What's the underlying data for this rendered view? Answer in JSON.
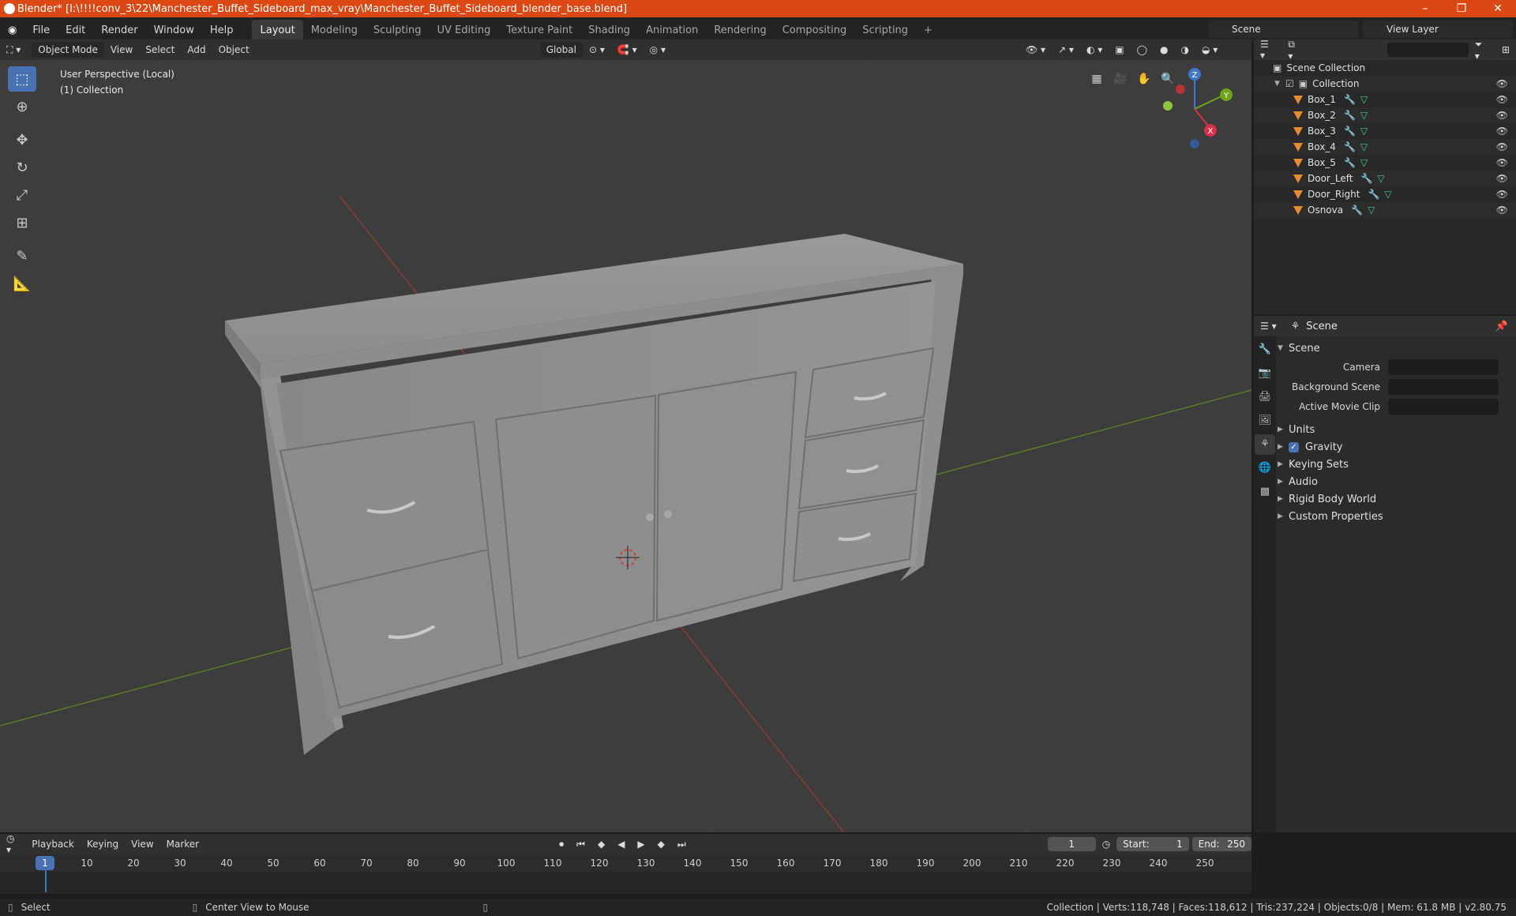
{
  "window": {
    "title": "Blender* [I:\\!!!!conv_3\\22\\Manchester_Buffet_Sideboard_max_vray\\Manchester_Buffet_Sideboard_blender_base.blend]",
    "controls": [
      "–",
      "❐",
      "✕"
    ]
  },
  "topbar": {
    "menu": [
      "File",
      "Edit",
      "Render",
      "Window",
      "Help"
    ],
    "workspaces": [
      "Layout",
      "Modeling",
      "Sculpting",
      "UV Editing",
      "Texture Paint",
      "Shading",
      "Animation",
      "Rendering",
      "Compositing",
      "Scripting"
    ],
    "active_workspace": "Layout",
    "add_workspace": "+",
    "scene": "Scene",
    "view_layer": "View Layer"
  },
  "viewport_header": {
    "mode": "Object Mode",
    "menus": [
      "View",
      "Select",
      "Add",
      "Object"
    ],
    "orientation": "Global"
  },
  "viewport": {
    "info_line1": "User Perspective (Local)",
    "info_line2": "(1) Collection",
    "gizmo": {
      "x": "X",
      "y": "Y",
      "z": "Z"
    }
  },
  "outliner": {
    "root": "Scene Collection",
    "collection": "Collection",
    "objects": [
      "Box_1",
      "Box_2",
      "Box_3",
      "Box_4",
      "Box_5",
      "Door_Left",
      "Door_Right",
      "Osnova"
    ]
  },
  "properties": {
    "context": "Scene",
    "panel": "Scene",
    "fields": [
      {
        "label": "Camera",
        "value": ""
      },
      {
        "label": "Background Scene",
        "value": ""
      },
      {
        "label": "Active Movie Clip",
        "value": ""
      }
    ],
    "sections": [
      "Units",
      "Gravity",
      "Keying Sets",
      "Audio",
      "Rigid Body World",
      "Custom Properties"
    ],
    "gravity_checked": true
  },
  "timeline": {
    "menus": [
      "Playback",
      "Keying",
      "View",
      "Marker"
    ],
    "current_frame": "1",
    "start_label": "Start:",
    "start": "1",
    "end_label": "End:",
    "end": "250",
    "ticks": [
      "1",
      "10",
      "20",
      "30",
      "40",
      "50",
      "60",
      "70",
      "80",
      "90",
      "100",
      "110",
      "120",
      "130",
      "140",
      "150",
      "160",
      "170",
      "180",
      "190",
      "200",
      "210",
      "220",
      "230",
      "240",
      "250"
    ]
  },
  "statusbar": {
    "left1": "Select",
    "left2": "Center View to Mouse",
    "right": "Collection | Verts:118,748 | Faces:118,612 | Tris:237,224 | Objects:0/8 | Mem: 61.8 MB | v2.80.75"
  }
}
